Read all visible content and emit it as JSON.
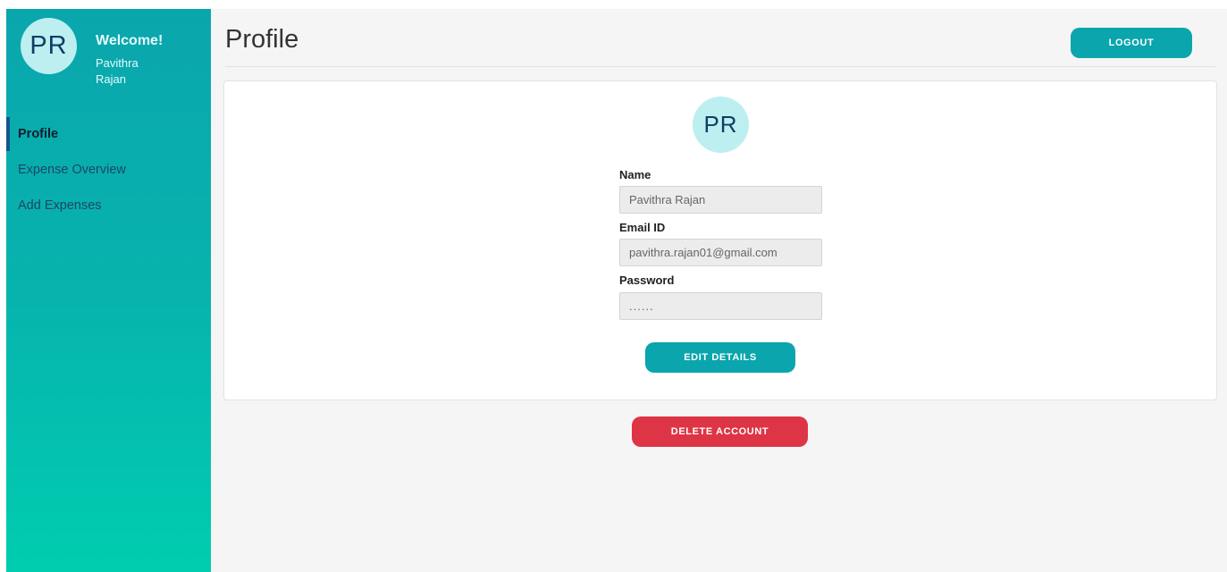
{
  "sidebar": {
    "avatar_initials": "PR",
    "welcome": "Welcome!",
    "user_name": "Pavithra Rajan",
    "items": [
      {
        "label": "Profile",
        "active": true
      },
      {
        "label": "Expense Overview",
        "active": false
      },
      {
        "label": "Add Expenses",
        "active": false
      }
    ]
  },
  "header": {
    "title": "Profile",
    "logout_label": "LOGOUT"
  },
  "profile": {
    "avatar_initials": "PR",
    "name_label": "Name",
    "name_value": "Pavithra Rajan",
    "email_label": "Email ID",
    "email_value": "pavithra.rajan01@gmail.com",
    "password_label": "Password",
    "password_value": "......",
    "edit_label": "EDIT DETAILS"
  },
  "delete_label": "DELETE ACCOUNT",
  "colors": {
    "accent": "#0aa5ad",
    "danger": "#dd3545",
    "avatar_bg": "#bdeff0",
    "sidebar_top": "#0aa6ad",
    "sidebar_bottom": "#00cdb0"
  }
}
